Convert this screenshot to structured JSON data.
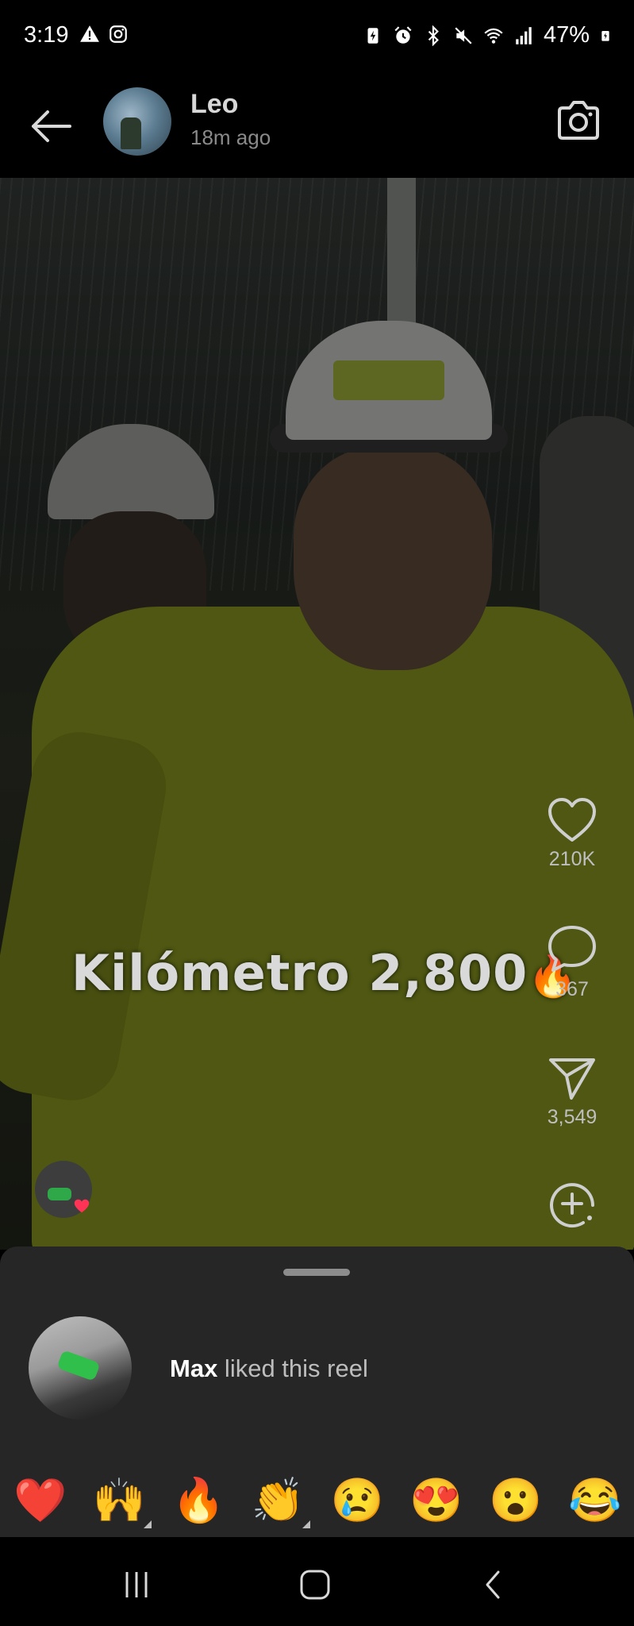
{
  "status_bar": {
    "time": "3:19",
    "battery": "47%"
  },
  "header": {
    "user_name": "Leo",
    "time_ago": "18m ago"
  },
  "reel": {
    "caption": "Kilómetro 2,800",
    "caption_emoji": "🔥",
    "likes": "210K",
    "comments": "367",
    "shares": "3,549"
  },
  "sheet": {
    "liker_name": "Max",
    "liked_text": " liked this reel",
    "reactions": [
      "❤️",
      "🙌",
      "🔥",
      "👏",
      "😢",
      "😍",
      "😮",
      "😂"
    ]
  },
  "icons": {
    "back": "arrow-left-icon",
    "camera": "camera-icon",
    "like": "heart-outline-icon",
    "comment": "comment-bubble-icon",
    "share": "paper-plane-icon",
    "remix": "add-circle-icon"
  },
  "colors": {
    "background": "#000000",
    "sheet": "#262626",
    "heart": "#ff3355"
  }
}
